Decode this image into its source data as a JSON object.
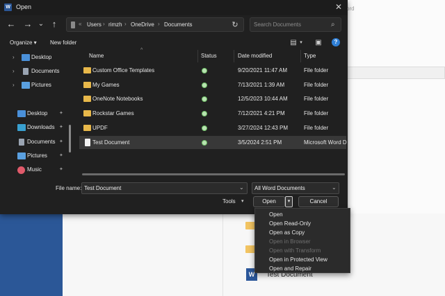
{
  "background": {
    "word_ribbon_text": "ord",
    "doc_label": "Test Document",
    "word_icon_letter": "W",
    "colors": {
      "accent": "#2b5797"
    }
  },
  "titlebar": {
    "icon_letter": "W",
    "title": "Open",
    "close_icon": "close-icon"
  },
  "navigation": {
    "back": "←",
    "forward": "→",
    "recent": "⌄",
    "up": "↑",
    "breadcrumb": [
      "Users",
      "rimzh",
      "OneDrive",
      "Documents"
    ],
    "breadcrumb_sep": "›",
    "prefix": "«",
    "refresh": "↻",
    "search_placeholder": "Search Documents",
    "search_icon": "⌕"
  },
  "toolbar": {
    "organize": "Organize ▾",
    "new_folder": "New folder",
    "view_icon": "▤",
    "view_dd": "▾",
    "preview_icon": "▣",
    "help": "?"
  },
  "sidebar": {
    "items": [
      {
        "label": "Desktop",
        "icon": "desktop-icon",
        "chevron": "›",
        "pinned": false,
        "color": "#4a90d9"
      },
      {
        "label": "Documents",
        "icon": "documents-icon",
        "chevron": "›",
        "pinned": false,
        "color": "#9aa4b2"
      },
      {
        "label": "Pictures",
        "icon": "pictures-icon",
        "chevron": "›",
        "pinned": false,
        "color": "#5aa0e0"
      },
      {
        "label": "Desktop",
        "icon": "desktop-icon",
        "chevron": "",
        "pinned": true,
        "color": "#4a90d9"
      },
      {
        "label": "Downloads",
        "icon": "downloads-icon",
        "chevron": "",
        "pinned": true,
        "color": "#39a0d0"
      },
      {
        "label": "Documents",
        "icon": "documents-icon",
        "chevron": "",
        "pinned": true,
        "color": "#9aa4b2"
      },
      {
        "label": "Pictures",
        "icon": "pictures-icon",
        "chevron": "",
        "pinned": true,
        "color": "#5aa0e0"
      },
      {
        "label": "Music",
        "icon": "music-icon",
        "chevron": "",
        "pinned": true,
        "color": "#e05a6a"
      }
    ],
    "pin_glyph": "📌"
  },
  "file_list": {
    "columns": [
      "Name",
      "Status",
      "Date modified",
      "Type"
    ],
    "sort_caret": "^",
    "rows": [
      {
        "name": "Custom Office Templates",
        "date": "9/20/2021 11:47 AM",
        "type": "File folder",
        "kind": "folder",
        "selected": false
      },
      {
        "name": "My Games",
        "date": "7/13/2021 1:39 AM",
        "type": "File folder",
        "kind": "folder",
        "selected": false
      },
      {
        "name": "OneNote Notebooks",
        "date": "12/5/2023 10:44 AM",
        "type": "File folder",
        "kind": "folder",
        "selected": false
      },
      {
        "name": "Rockstar Games",
        "date": "7/12/2021 4:21 PM",
        "type": "File folder",
        "kind": "folder",
        "selected": false
      },
      {
        "name": "UPDF",
        "date": "3/27/2024 12:43 PM",
        "type": "File folder",
        "kind": "folder",
        "selected": false
      },
      {
        "name": "Test Document",
        "date": "3/5/2024 2:51 PM",
        "type": "Microsoft Word D",
        "kind": "doc",
        "selected": true
      }
    ]
  },
  "footer": {
    "file_name_label": "File name:",
    "file_name_value": "Test Document",
    "file_type_value": "All Word Documents",
    "dd_chevron": "⌄",
    "tools_label": "Tools",
    "tools_chevron": "▾",
    "open_label": "Open",
    "open_split": "▾",
    "cancel_label": "Cancel"
  },
  "open_menu": {
    "items": [
      {
        "label": "Open",
        "enabled": true
      },
      {
        "label": "Open Read-Only",
        "enabled": true
      },
      {
        "label": "Open as Copy",
        "enabled": true
      },
      {
        "label": "Open in Browser",
        "enabled": false
      },
      {
        "label": "Open with Transform",
        "enabled": false
      },
      {
        "label": "Open in Protected View",
        "enabled": true
      },
      {
        "label": "Open and Repair",
        "enabled": true
      }
    ]
  }
}
